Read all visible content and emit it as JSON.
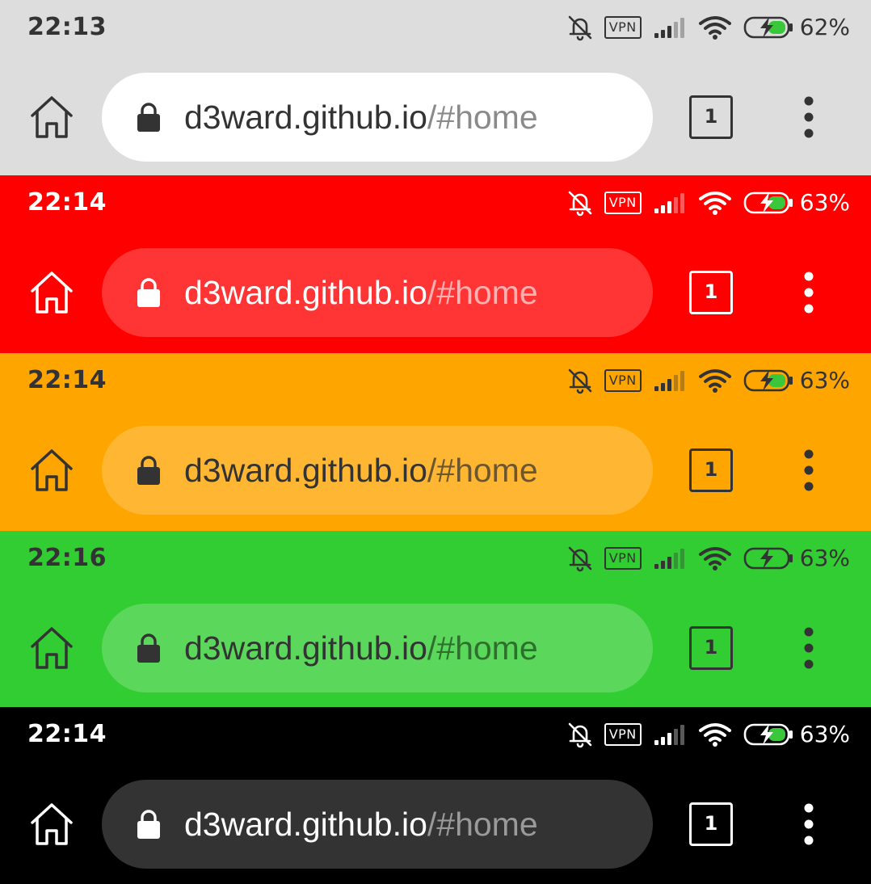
{
  "panels": [
    {
      "clock": "22:13",
      "battery_percent": "62%",
      "vpn_label": "VPN",
      "url_host": "d3ward.github.io",
      "url_path": "/#home",
      "tab_count": "1",
      "colors": {
        "background": "#dddddd",
        "foreground": "#333333",
        "omnibox": "#ffffff",
        "url_host": "#333333",
        "url_path": "#8a8a8a",
        "battery_charge": "#3ac73a"
      },
      "icons": [
        "home-icon",
        "lock-icon",
        "mute-bell-icon",
        "signal-icon",
        "wifi-icon",
        "battery-charging-icon",
        "more-vert-icon"
      ]
    },
    {
      "clock": "22:14",
      "battery_percent": "63%",
      "vpn_label": "VPN",
      "url_host": "d3ward.github.io",
      "url_path": "/#home",
      "tab_count": "1",
      "colors": {
        "background": "#ff0000",
        "foreground": "#ffffff",
        "omnibox": "#ff3535",
        "url_host": "#ffffff",
        "url_path": "#ffb0b0",
        "battery_charge": "#3ac73a"
      },
      "icons": [
        "home-icon",
        "lock-icon",
        "mute-bell-icon",
        "signal-icon",
        "wifi-icon",
        "battery-charging-icon",
        "more-vert-icon"
      ]
    },
    {
      "clock": "22:14",
      "battery_percent": "63%",
      "vpn_label": "VPN",
      "url_host": "d3ward.github.io",
      "url_path": "/#home",
      "tab_count": "1",
      "colors": {
        "background": "#ffa500",
        "foreground": "#333333",
        "omnibox": "#ffb733",
        "url_host": "#333333",
        "url_path": "#6b5630",
        "battery_charge": "#3ac73a"
      },
      "icons": [
        "home-icon",
        "lock-icon",
        "mute-bell-icon",
        "signal-icon",
        "wifi-icon",
        "battery-charging-icon",
        "more-vert-icon"
      ]
    },
    {
      "clock": "22:16",
      "battery_percent": "63%",
      "vpn_label": "VPN",
      "url_host": "d3ward.github.io",
      "url_path": "/#home",
      "tab_count": "1",
      "colors": {
        "background": "#32cd32",
        "foreground": "#333333",
        "omnibox": "#5bd75b",
        "url_host": "#333333",
        "url_path": "#2d6f2d",
        "battery_charge": "#32cd32"
      },
      "icons": [
        "home-icon",
        "lock-icon",
        "mute-bell-icon",
        "signal-icon",
        "wifi-icon",
        "battery-charging-icon",
        "more-vert-icon"
      ]
    },
    {
      "clock": "22:14",
      "battery_percent": "63%",
      "vpn_label": "VPN",
      "url_host": "d3ward.github.io",
      "url_path": "/#home",
      "tab_count": "1",
      "colors": {
        "background": "#000000",
        "foreground": "#ffffff",
        "omnibox": "#333333",
        "url_host": "#ffffff",
        "url_path": "#9a9a9a",
        "battery_charge": "#3ac73a"
      },
      "icons": [
        "home-icon",
        "lock-icon",
        "mute-bell-icon",
        "signal-icon",
        "wifi-icon",
        "battery-charging-icon",
        "more-vert-icon"
      ]
    }
  ]
}
